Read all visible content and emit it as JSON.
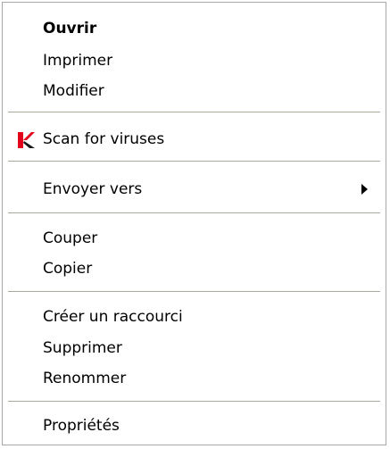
{
  "context_menu": {
    "items": [
      {
        "label": "Ouvrir"
      },
      {
        "label": "Imprimer"
      },
      {
        "label": "Modifier"
      },
      {
        "label": "Scan for viruses",
        "icon": "kaspersky-icon"
      },
      {
        "label": "Envoyer vers",
        "icon": "submenu-arrow-icon"
      },
      {
        "label": "Couper"
      },
      {
        "label": "Copier"
      },
      {
        "label": "Créer un raccourci"
      },
      {
        "label": "Supprimer"
      },
      {
        "label": "Renommer"
      },
      {
        "label": "Propriétés"
      }
    ]
  },
  "colors": {
    "kaspersky_red": "#e2001a",
    "separator": "#aca899",
    "border": "#a7a6aa"
  }
}
